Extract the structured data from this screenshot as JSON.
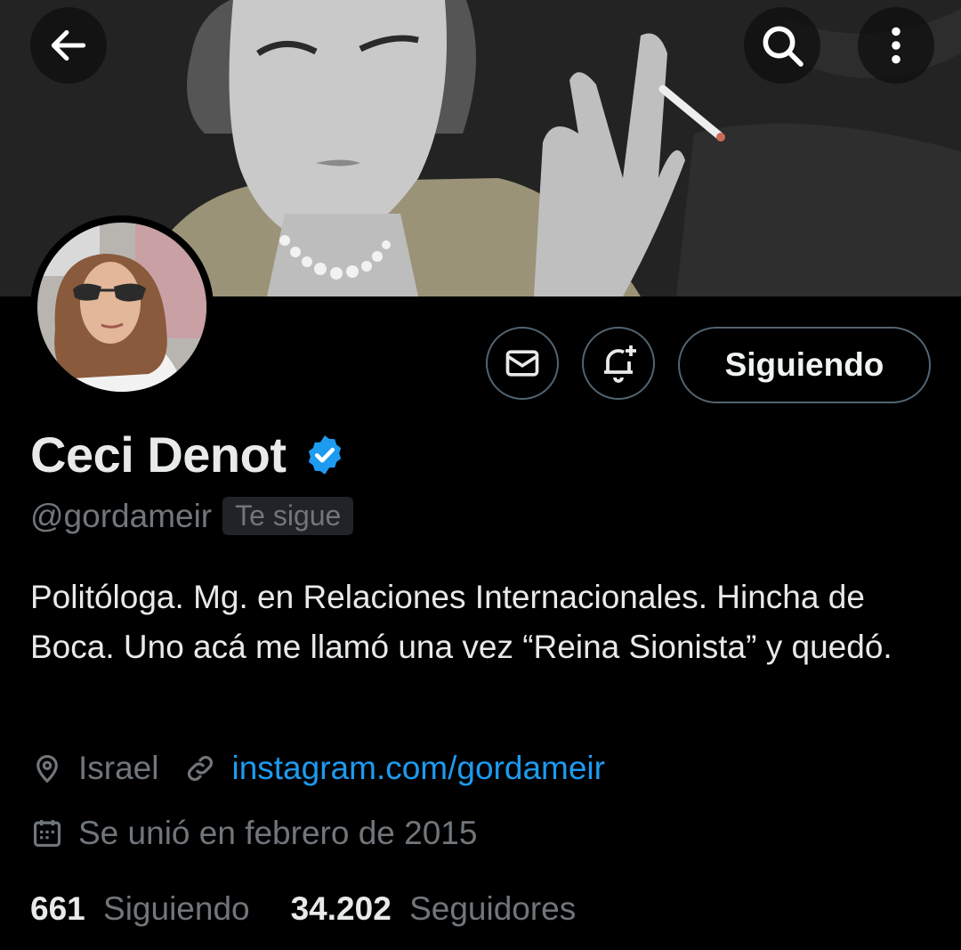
{
  "profile": {
    "name": "Ceci Denot",
    "handle": "@gordameir",
    "follows_you": "Te sigue",
    "bio": "Politóloga. Mg. en Relaciones Internacionales. Hincha de Boca. Uno acá me llamó una vez “Reina Sionista” y quedó.",
    "location": "Israel",
    "website": "instagram.com/gordameir",
    "joined": "Se unió en febrero de 2015",
    "following_count": "661",
    "following_label": "Siguiendo",
    "followers_count": "34.202",
    "followers_label": "Seguidores",
    "verified": true
  },
  "actions": {
    "follow_state_label": "Siguiendo"
  },
  "icons": {
    "back": "arrow-left-icon",
    "search": "search-icon",
    "more": "more-vertical-icon",
    "message": "envelope-icon",
    "notify": "bell-plus-icon",
    "verified": "verified-badge-icon",
    "location": "location-pin-icon",
    "link": "link-icon",
    "calendar": "calendar-icon"
  },
  "colors": {
    "background": "#000000",
    "accent": "#1d9bf0",
    "muted": "#71767b",
    "border": "#536471"
  }
}
